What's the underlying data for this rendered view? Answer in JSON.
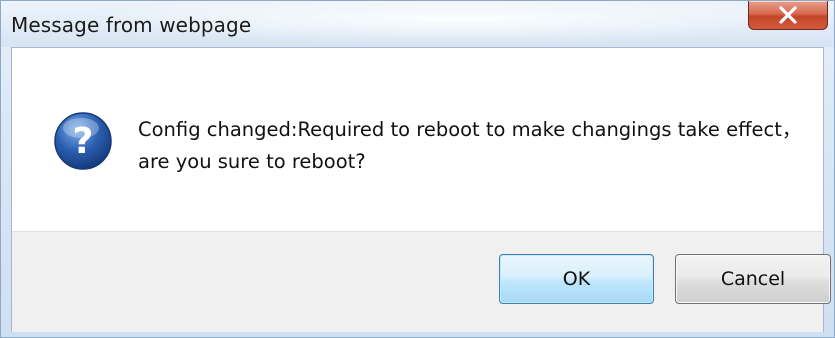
{
  "window": {
    "title": "Message from webpage",
    "close_icon": "close-x-icon"
  },
  "dialog": {
    "icon": "question-icon",
    "message": "Config changed:Required to reboot to make changings take effect，are you sure to reboot?"
  },
  "buttons": {
    "ok_label": "OK",
    "cancel_label": "Cancel"
  },
  "colors": {
    "icon_blue": "#2b5fb0",
    "close_red": "#c3452a",
    "focus_border": "#3c7fb1"
  }
}
